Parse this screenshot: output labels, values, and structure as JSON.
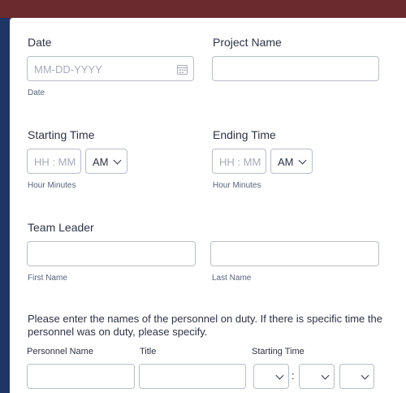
{
  "date": {
    "label": "Date",
    "placeholder": "MM-DD-YYYY",
    "sublabel": "Date"
  },
  "project": {
    "label": "Project Name",
    "value": ""
  },
  "starting_time": {
    "label": "Starting Time",
    "placeholder": "HH : MM",
    "ampm": "AM",
    "sublabel": "Hour Minutes"
  },
  "ending_time": {
    "label": "Ending Time",
    "placeholder": "HH : MM",
    "ampm": "AM",
    "sublabel": "Hour Minutes"
  },
  "team_leader": {
    "label": "Team Leader",
    "first_sublabel": "First Name",
    "last_sublabel": "Last Name",
    "first_value": "",
    "last_value": ""
  },
  "personnel": {
    "instructions": "Please enter the names of the personnel on duty. If there is specific time the personnel was on duty, please specify.",
    "columns": [
      "Personnel Name",
      "Title",
      "Starting Time"
    ],
    "time_separator": ":"
  },
  "colors": {
    "page_bg": "#6b2a2e",
    "left_band": "#1e3566",
    "card": "#ffffff",
    "border": "#b8bdc9"
  }
}
